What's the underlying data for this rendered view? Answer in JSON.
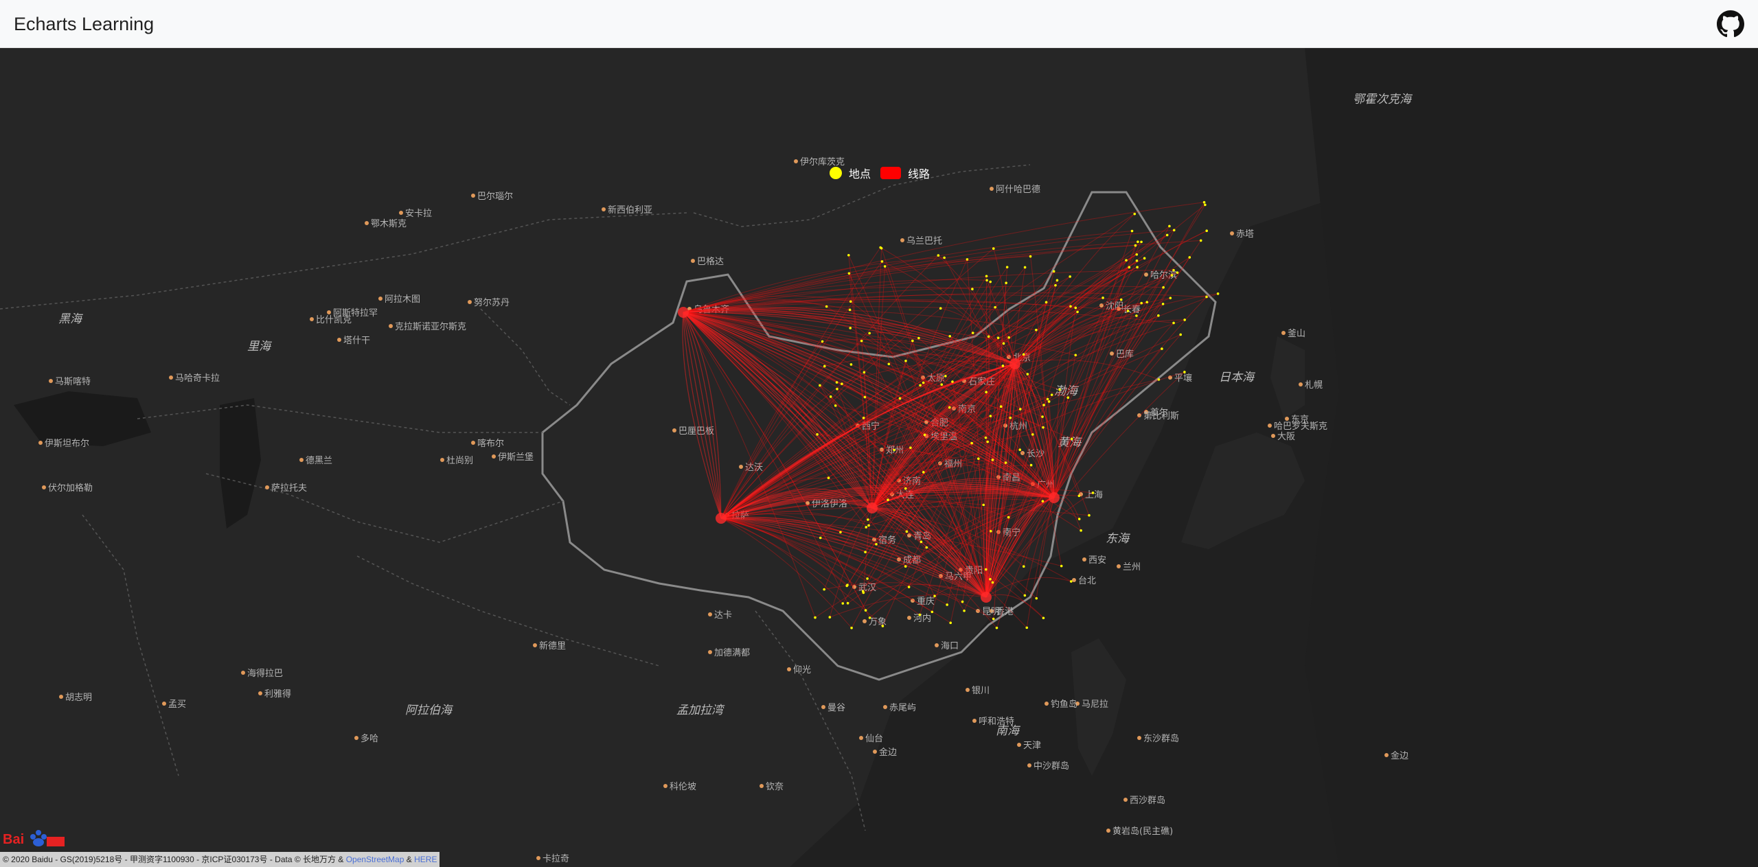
{
  "app": {
    "title": "Echarts Learning"
  },
  "header": {
    "github_icon": "github-icon"
  },
  "legend": [
    {
      "name": "地点",
      "color": "#ffff00",
      "symbol": "circle"
    },
    {
      "name": "线路",
      "color": "#ff0000",
      "symbol": "roundRect"
    }
  ],
  "map": {
    "background": "#202020",
    "land": "#262626",
    "labels": [
      {
        "t": "日本海",
        "c": "sea"
      },
      {
        "t": "鄂霍次克海",
        "c": "sea"
      },
      {
        "t": "黄海",
        "c": "sea"
      },
      {
        "t": "东海",
        "c": "sea"
      },
      {
        "t": "渤海",
        "c": "sea"
      },
      {
        "t": "南海",
        "c": "sea"
      },
      {
        "t": "阿拉伯海",
        "c": "sea"
      },
      {
        "t": "孟加拉湾",
        "c": "sea"
      },
      {
        "t": "黑海",
        "c": "sea"
      },
      {
        "t": "里海",
        "c": "sea"
      },
      {
        "t": "北京",
        "c": "city"
      },
      {
        "t": "上海",
        "c": "city"
      },
      {
        "t": "香港",
        "c": "city"
      },
      {
        "t": "乌鲁木齐",
        "c": "city"
      },
      {
        "t": "拉萨",
        "c": "city"
      },
      {
        "t": "西宁",
        "c": "city"
      },
      {
        "t": "沈阳",
        "c": "city"
      },
      {
        "t": "长春",
        "c": "city"
      },
      {
        "t": "哈尔滨",
        "c": "city"
      },
      {
        "t": "平壤",
        "c": "city"
      },
      {
        "t": "首尔",
        "c": "city"
      },
      {
        "t": "乌兰巴托",
        "c": "city"
      },
      {
        "t": "海口",
        "c": "city"
      },
      {
        "t": "台北",
        "c": "city"
      },
      {
        "t": "东京",
        "c": "city"
      },
      {
        "t": "大阪",
        "c": "city"
      },
      {
        "t": "河内",
        "c": "city"
      },
      {
        "t": "曼谷",
        "c": "city"
      },
      {
        "t": "马尼拉",
        "c": "city"
      },
      {
        "t": "加德满都",
        "c": "city"
      },
      {
        "t": "新德里",
        "c": "city"
      },
      {
        "t": "达卡",
        "c": "city"
      },
      {
        "t": "仰光",
        "c": "city"
      },
      {
        "t": "万象",
        "c": "city"
      },
      {
        "t": "喀布尔",
        "c": "city"
      },
      {
        "t": "伊斯兰堡",
        "c": "city"
      },
      {
        "t": "德黑兰",
        "c": "city"
      },
      {
        "t": "巴格达",
        "c": "city"
      },
      {
        "t": "努尔苏丹",
        "c": "city"
      },
      {
        "t": "阿拉木图",
        "c": "city"
      },
      {
        "t": "比什凯克",
        "c": "city"
      },
      {
        "t": "塔什干",
        "c": "city"
      },
      {
        "t": "杜尚别",
        "c": "city"
      },
      {
        "t": "阿什哈巴德",
        "c": "city"
      },
      {
        "t": "新西伯利亚",
        "c": "city"
      },
      {
        "t": "伊尔库茨克",
        "c": "city"
      },
      {
        "t": "赤塔",
        "c": "city"
      },
      {
        "t": "哈巴罗夫斯克",
        "c": "city"
      },
      {
        "t": "釜山",
        "c": "city"
      },
      {
        "t": "札幌",
        "c": "city"
      },
      {
        "t": "仙台",
        "c": "city"
      },
      {
        "t": "金边",
        "c": "city"
      },
      {
        "t": "胡志明",
        "c": "city"
      },
      {
        "t": "孟买",
        "c": "city"
      },
      {
        "t": "卡拉奇",
        "c": "city"
      },
      {
        "t": "科伦坡",
        "c": "city"
      },
      {
        "t": "钦奈",
        "c": "city"
      },
      {
        "t": "海得拉巴",
        "c": "city"
      },
      {
        "t": "利雅得",
        "c": "city"
      },
      {
        "t": "多哈",
        "c": "city"
      },
      {
        "t": "马斯喀特",
        "c": "city"
      },
      {
        "t": "伊斯坦布尔",
        "c": "city"
      },
      {
        "t": "安卡拉",
        "c": "city"
      },
      {
        "t": "鄂木斯克",
        "c": "city"
      },
      {
        "t": "巴尔瑙尔",
        "c": "city"
      },
      {
        "t": "克拉斯诺亚尔斯克",
        "c": "city"
      },
      {
        "t": "阿斯特拉罕",
        "c": "city"
      },
      {
        "t": "萨拉托夫",
        "c": "city"
      },
      {
        "t": "伏尔加格勒",
        "c": "city"
      },
      {
        "t": "马哈奇卡拉",
        "c": "city"
      },
      {
        "t": "巴库",
        "c": "city"
      },
      {
        "t": "第比利斯",
        "c": "city"
      },
      {
        "t": "埃里温",
        "c": "city"
      },
      {
        "t": "大连",
        "c": "city"
      },
      {
        "t": "青岛",
        "c": "city"
      },
      {
        "t": "武汉",
        "c": "city"
      },
      {
        "t": "成都",
        "c": "city"
      },
      {
        "t": "重庆",
        "c": "city"
      },
      {
        "t": "昆明",
        "c": "city"
      },
      {
        "t": "贵阳",
        "c": "city"
      },
      {
        "t": "南宁",
        "c": "city"
      },
      {
        "t": "广州",
        "c": "city"
      },
      {
        "t": "长沙",
        "c": "city"
      },
      {
        "t": "南昌",
        "c": "city"
      },
      {
        "t": "福州",
        "c": "city"
      },
      {
        "t": "杭州",
        "c": "city"
      },
      {
        "t": "南京",
        "c": "city"
      },
      {
        "t": "合肥",
        "c": "city"
      },
      {
        "t": "郑州",
        "c": "city"
      },
      {
        "t": "济南",
        "c": "city"
      },
      {
        "t": "太原",
        "c": "city"
      },
      {
        "t": "石家庄",
        "c": "city"
      },
      {
        "t": "西安",
        "c": "city"
      },
      {
        "t": "兰州",
        "c": "city"
      },
      {
        "t": "银川",
        "c": "city"
      },
      {
        "t": "呼和浩特",
        "c": "city"
      },
      {
        "t": "天津",
        "c": "city"
      },
      {
        "t": "钓鱼岛",
        "c": "city"
      },
      {
        "t": "赤尾屿",
        "c": "city"
      },
      {
        "t": "东沙群岛",
        "c": "city"
      },
      {
        "t": "西沙群岛",
        "c": "city"
      },
      {
        "t": "中沙群岛",
        "c": "city"
      },
      {
        "t": "黄岩岛(民主礁)",
        "c": "city"
      },
      {
        "t": "金边",
        "c": "city"
      },
      {
        "t": "巴厘巴板",
        "c": "city"
      },
      {
        "t": "达沃",
        "c": "city"
      },
      {
        "t": "伊洛伊洛",
        "c": "city"
      },
      {
        "t": "宿务",
        "c": "city"
      },
      {
        "t": "马六甲",
        "c": "city"
      }
    ]
  },
  "footer": {
    "copyright": "© 2020 Baidu - GS(2019)5218号 - 甲测资字1100930 - 京ICP证030173号 - Data © 长地万方 &",
    "osm": "OpenStreetMap",
    "amp": "&",
    "here": "HERE",
    "logo_text": "Bai度地图"
  }
}
